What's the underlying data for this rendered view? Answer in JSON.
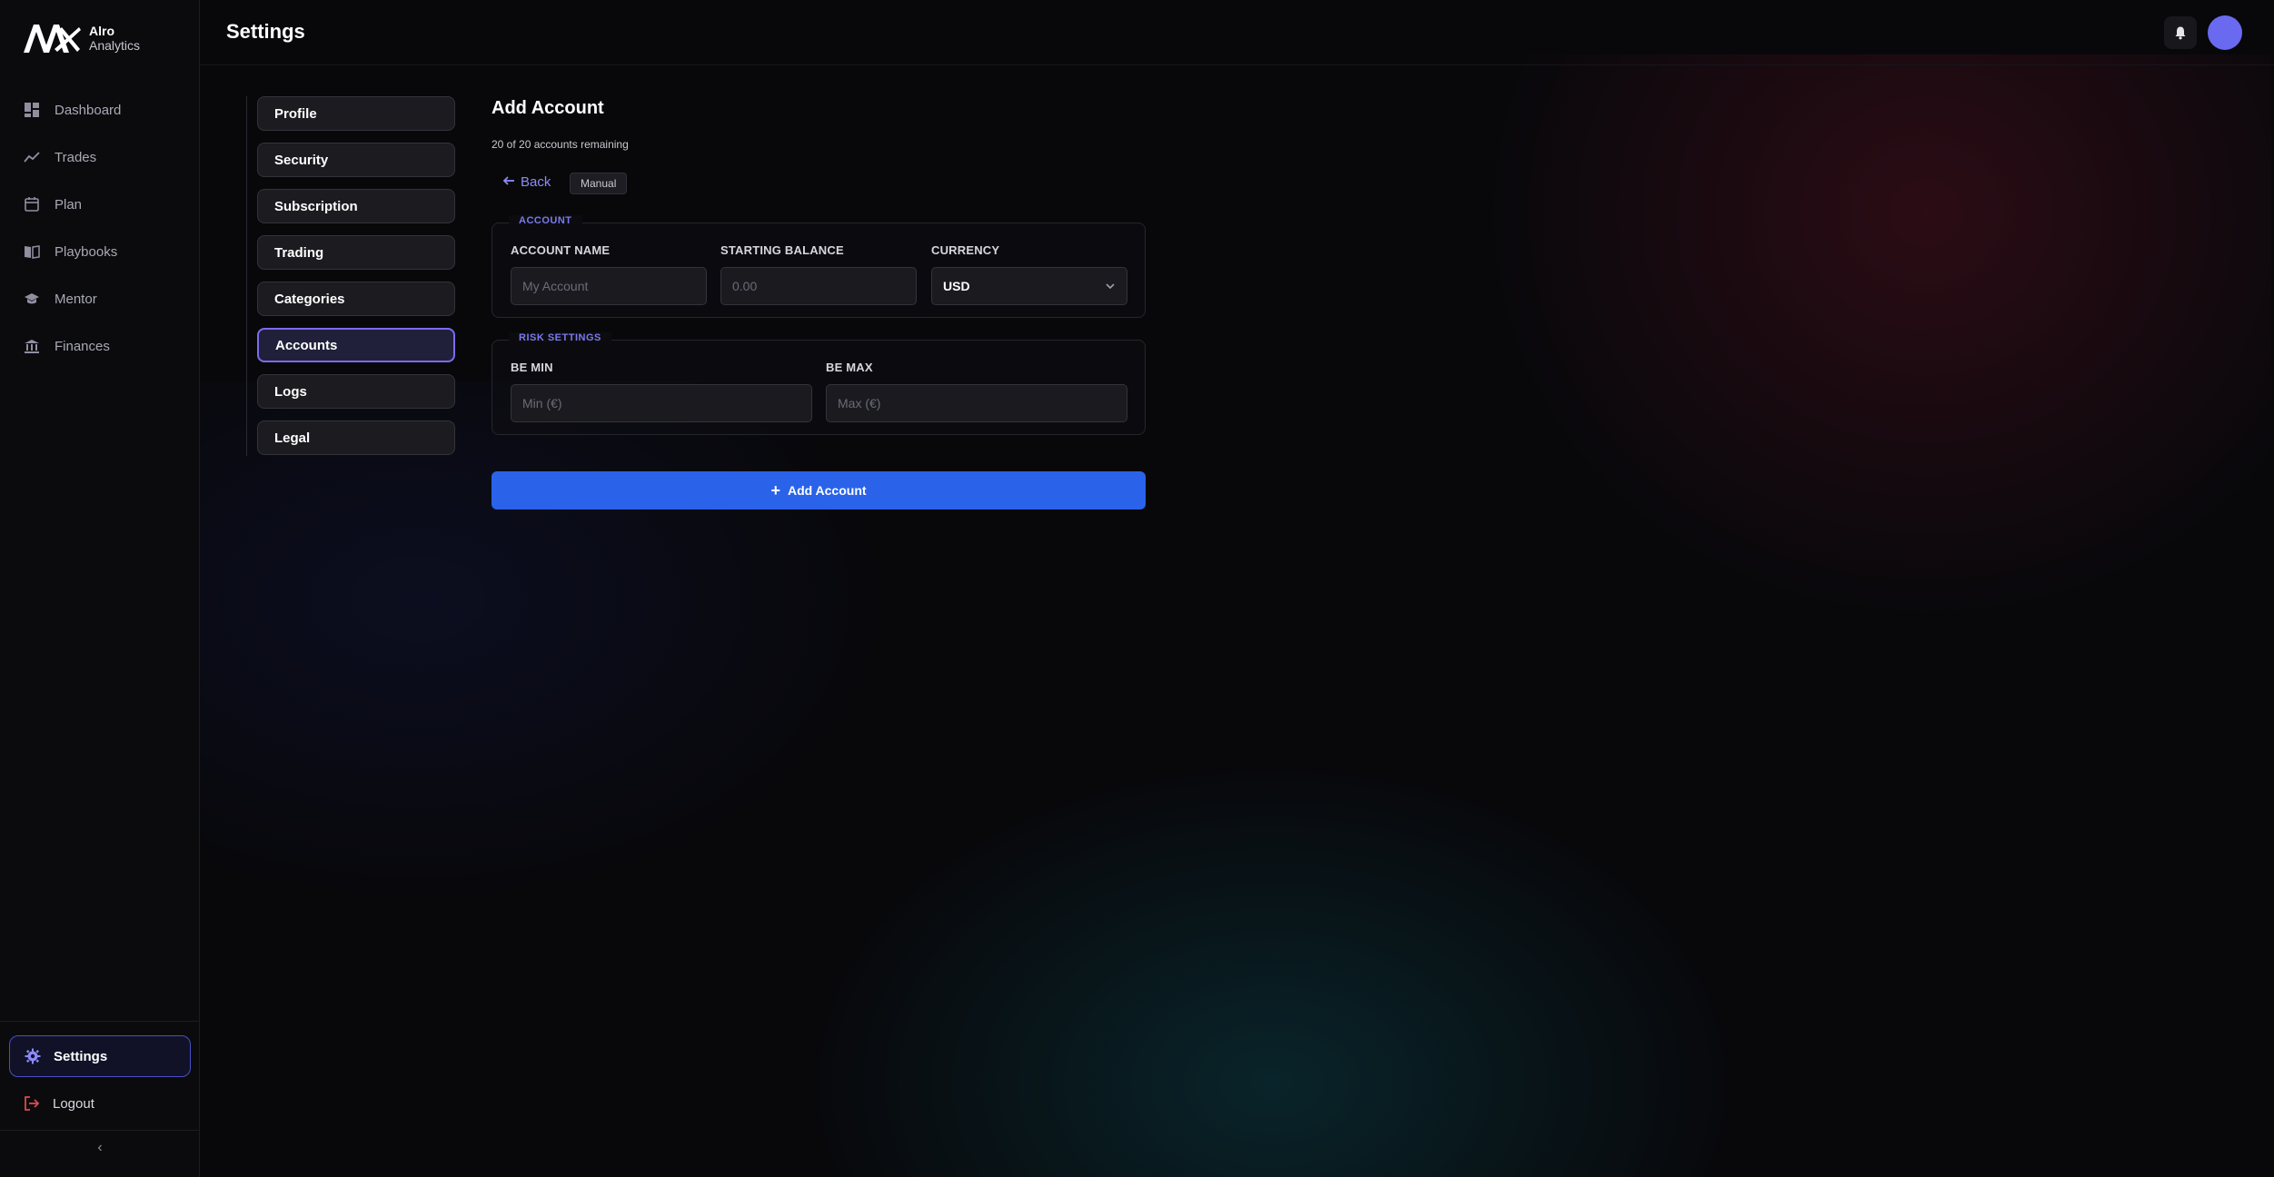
{
  "brand": {
    "name": "Alro",
    "sub": "Analytics"
  },
  "sidebar": {
    "items": [
      {
        "label": "Dashboard",
        "icon": "dashboard-icon"
      },
      {
        "label": "Trades",
        "icon": "trend-line-icon"
      },
      {
        "label": "Plan",
        "icon": "calendar-icon"
      },
      {
        "label": "Playbooks",
        "icon": "book-icon"
      },
      {
        "label": "Mentor",
        "icon": "graduation-cap-icon"
      },
      {
        "label": "Finances",
        "icon": "bank-icon"
      }
    ],
    "settings_label": "Settings",
    "logout_label": "Logout",
    "collapse_glyph": "‹"
  },
  "header": {
    "title": "Settings"
  },
  "settings_menu": {
    "items": [
      "Profile",
      "Security",
      "Subscription",
      "Trading",
      "Categories",
      "Accounts",
      "Logs",
      "Legal"
    ],
    "active": "Accounts"
  },
  "form": {
    "title": "Add Account",
    "remaining": "20 of 20 accounts remaining",
    "back_label": "Back",
    "mode_tag": "Manual",
    "account_section": {
      "legend": "ACCOUNT",
      "name_label": "ACCOUNT NAME",
      "name_placeholder": "My Account",
      "balance_label": "STARTING BALANCE",
      "balance_placeholder": "0.00",
      "currency_label": "CURRENCY",
      "currency_value": "USD"
    },
    "risk_section": {
      "legend": "RISK SETTINGS",
      "be_min_label": "BE MIN",
      "be_min_placeholder": "Min (€)",
      "be_max_label": "BE MAX",
      "be_max_placeholder": "Max (€)"
    },
    "submit_label": "Add Account"
  },
  "colors": {
    "accent": "#7d6bf0",
    "primary_button": "#2a63ea",
    "avatar": "#6a6af0",
    "logout_icon": "#e0484f"
  }
}
